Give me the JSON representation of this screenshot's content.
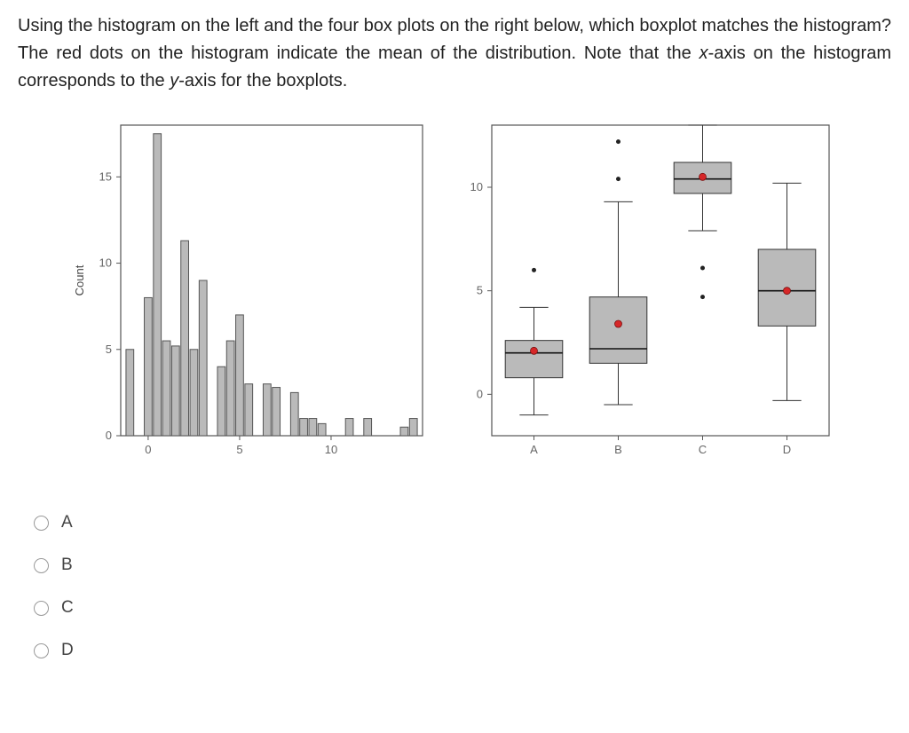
{
  "question_prefix": "Using the histogram on the left and the four box plots on the right below, which boxplot matches the histogram? The red dots on the histogram indicate the mean of the distribution. Note that the ",
  "question_x": "x",
  "question_mid": "-axis on the histogram corresponds to the ",
  "question_y": "y",
  "question_suffix": "-axis for the boxplots.",
  "options": [
    "A",
    "B",
    "C",
    "D"
  ],
  "chart_data": [
    {
      "type": "bar",
      "title": "",
      "xlabel": "",
      "ylabel": "Count",
      "xlim": [
        -1.5,
        15
      ],
      "ylim": [
        0,
        18
      ],
      "yticks": [
        0,
        5,
        10,
        15
      ],
      "xticks": [
        0,
        5,
        10
      ],
      "bin_centers": [
        -1,
        -0.5,
        0,
        0.5,
        1,
        1.5,
        2,
        2.5,
        3,
        3.5,
        4,
        4.5,
        5,
        5.5,
        6,
        6.5,
        7,
        7.5,
        8,
        8.5,
        9,
        9.5,
        10,
        10.5,
        11,
        11.5,
        12,
        12.5,
        13,
        13.5,
        14,
        14.5
      ],
      "values": [
        5,
        0,
        8,
        17.5,
        5.5,
        5.2,
        11.3,
        5,
        9,
        0,
        4,
        5.5,
        7,
        3,
        0,
        3,
        2.8,
        0,
        2.5,
        1,
        1,
        0.7,
        0,
        0,
        1,
        0,
        1,
        0,
        0,
        0,
        0.5,
        1
      ]
    },
    {
      "type": "boxplot",
      "title": "",
      "ylabel": "",
      "xlabel": "",
      "ylim": [
        -2,
        13
      ],
      "yticks": [
        0,
        5,
        10
      ],
      "categories": [
        "A",
        "B",
        "C",
        "D"
      ],
      "series": [
        {
          "name": "A",
          "min": -1,
          "q1": 0.8,
          "median": 2,
          "q3": 2.6,
          "max": 4.2,
          "mean": 2.1,
          "outliers": [
            6
          ]
        },
        {
          "name": "B",
          "min": -0.5,
          "q1": 1.5,
          "median": 2.2,
          "q3": 4.7,
          "max": 9.3,
          "mean": 3.4,
          "outliers": [
            10.4,
            12.2
          ]
        },
        {
          "name": "C",
          "min": 7.9,
          "q1": 9.7,
          "median": 10.4,
          "q3": 11.2,
          "max": 13,
          "mean": 10.5,
          "outliers": [
            6.1,
            4.7
          ]
        },
        {
          "name": "D",
          "min": -0.3,
          "q1": 3.3,
          "median": 5,
          "q3": 7,
          "max": 10.2,
          "mean": 5,
          "outliers": []
        }
      ]
    }
  ]
}
